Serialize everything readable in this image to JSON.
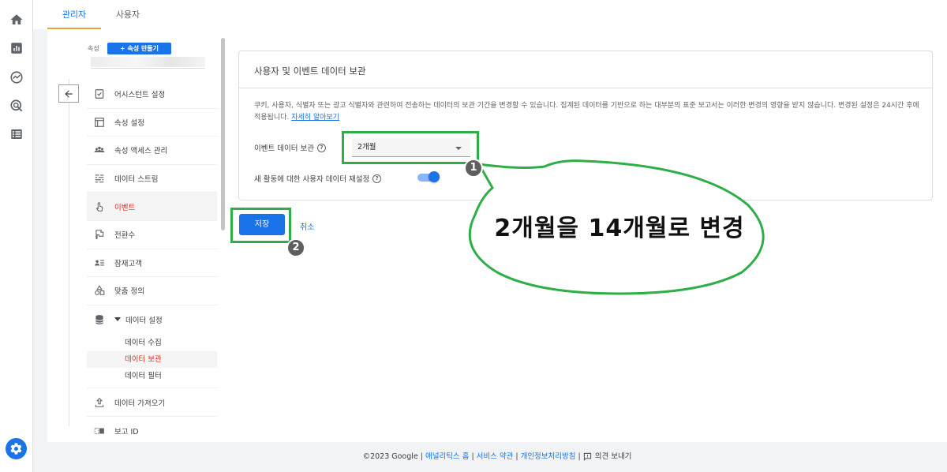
{
  "tabs": [
    {
      "label": "관리자",
      "active": true
    },
    {
      "label": "사용자",
      "active": false
    }
  ],
  "left_rail": {
    "icons": [
      "home-icon",
      "reports-icon",
      "explore-icon",
      "advertising-icon",
      "configure-icon"
    ],
    "settings_icon": "gear-icon",
    "accent_color": "#1a73e8"
  },
  "property": {
    "label": "속성",
    "create_button": "+ 속성 만들기"
  },
  "nav": {
    "items": [
      {
        "label": "어시스턴트 설정",
        "icon": "checklist-icon"
      },
      {
        "label": "속성 설정",
        "icon": "property-settings-icon"
      },
      {
        "label": "속성 액세스 관리",
        "icon": "people-icon"
      },
      {
        "label": "데이터 스트림",
        "icon": "data-streams-icon"
      },
      {
        "label": "이벤트",
        "icon": "touch-icon",
        "active": true
      },
      {
        "label": "전환수",
        "icon": "flag-icon"
      },
      {
        "label": "잠재고객",
        "icon": "audience-icon"
      },
      {
        "label": "맞춤 정의",
        "icon": "shapes-icon"
      },
      {
        "label": "데이터 설정",
        "icon": "database-icon",
        "expanded": true
      }
    ],
    "sub_items": [
      {
        "label": "데이터 수집"
      },
      {
        "label": "데이터 보관",
        "active": true
      },
      {
        "label": "데이터 필터"
      }
    ],
    "bottom_items": [
      {
        "label": "데이터 가져오기",
        "icon": "upload-icon"
      },
      {
        "label": "보고 ID",
        "icon": "reporting-id-icon"
      }
    ]
  },
  "card": {
    "title": "사용자 및 이벤트 데이터 보관",
    "description": "쿠키, 사용자, 식별자 또는 광고 식별자와 관련하여 전송하는 데이터의 보관 기간을 변경할 수 있습니다. 집계된 데이터를 기반으로 하는 대부분의 표준 보고서는 이러한 변경의 영향을 받지 않습니다. 변경된 설정은 24시간 후에 적용됩니다.",
    "learn_more": "자세히 알아보기",
    "event_retention_label": "이벤트 데이터 보관",
    "event_retention_value": "2개월",
    "reset_label": "새 활동에 대한 사용자 데이터 재설정",
    "reset_on": true
  },
  "actions": {
    "save": "저장",
    "cancel": "취소"
  },
  "annotation": {
    "badge1": "1",
    "badge2": "2",
    "callout_text": "2개월을 14개월로 변경",
    "color": "#2fae47"
  },
  "footer": {
    "copyright": "©2023 Google",
    "links": [
      "애널리틱스 홈",
      "서비스 약관",
      "개인정보처리방침"
    ],
    "feedback": "의견 보내기"
  }
}
